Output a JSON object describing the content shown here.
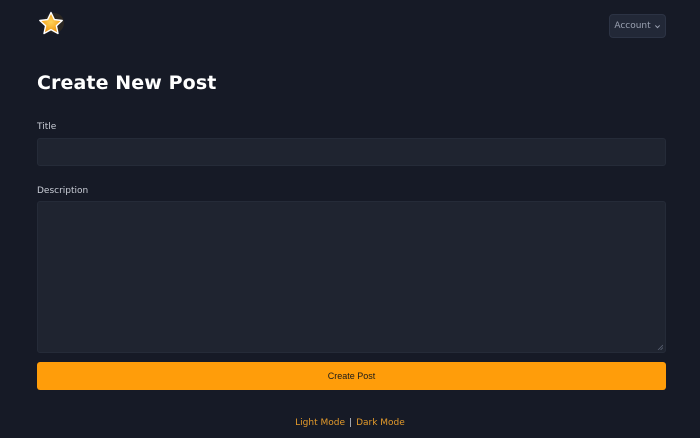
{
  "header": {
    "logo_icon": "star-icon",
    "account_label": "Account",
    "account_chevron": "chevron-down-icon"
  },
  "main": {
    "title": "Create New Post",
    "fields": {
      "title_label": "Title",
      "title_value": "",
      "description_label": "Description",
      "description_value": ""
    },
    "submit_label": "Create Post"
  },
  "footer": {
    "light_mode": "Light Mode",
    "separator": "|",
    "dark_mode": "Dark Mode"
  },
  "colors": {
    "background": "#161a26",
    "input_bg": "#1f2430",
    "accent": "#ff9d0a",
    "link": "#e39a2b"
  }
}
